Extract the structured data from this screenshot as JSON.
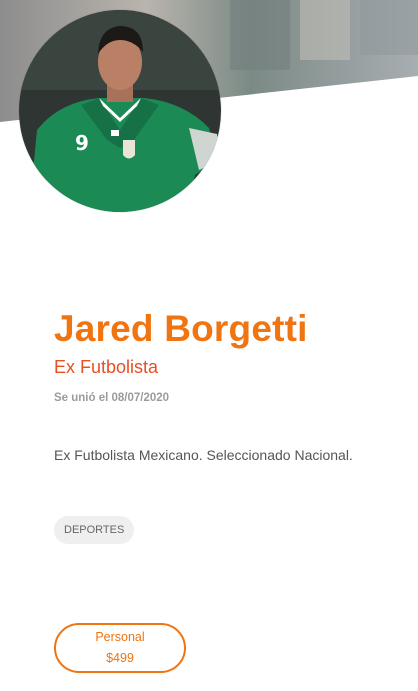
{
  "profile": {
    "name": "Jared Borgetti",
    "role": "Ex Futbolista",
    "joined": "Se unió el 08/07/2020",
    "bio": "Ex Futbolista Mexicano. Seleccionado Nacional.",
    "category_tag": "DEPORTES",
    "avatar_jersey_number": "9"
  },
  "subscription": {
    "plan_label": "Personal",
    "price": "$499"
  },
  "colors": {
    "accent": "#f07410",
    "role": "#e84f24",
    "muted": "#9b9b9b",
    "jersey": "#1c8a55"
  },
  "icons": {
    "avatar": "profile-photo"
  }
}
